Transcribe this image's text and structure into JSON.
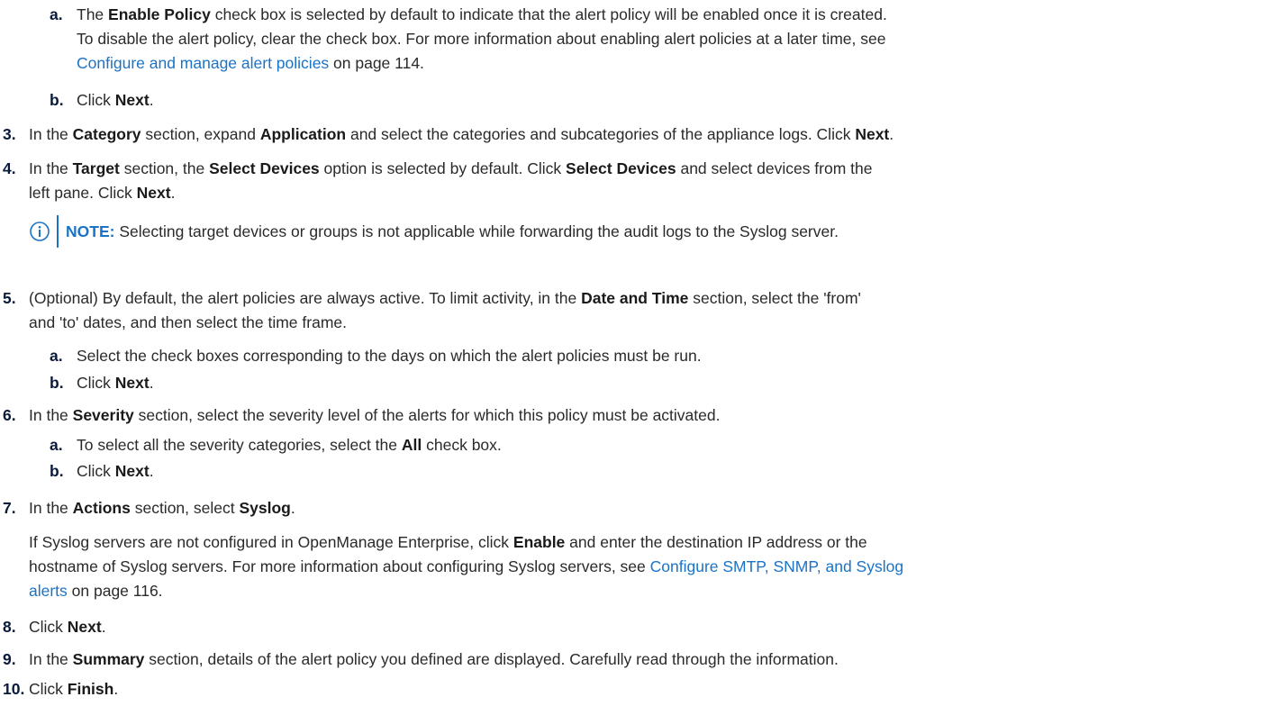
{
  "steps": {
    "s2a": {
      "marker": "a.",
      "p1": "The ",
      "b1": "Enable Policy",
      "p2": " check box is selected by default to indicate that the alert policy will be enabled once it is created."
    },
    "s2a_cont": {
      "p1": "To disable the alert policy, clear the check box. For more information about enabling alert policies at a later time, see"
    },
    "s2a_cont2": {
      "link": "Configure and manage alert policies",
      "p1": " on page 114."
    },
    "s2b": {
      "marker": "b.",
      "p1": "Click ",
      "b1": "Next",
      "p2": "."
    },
    "s3": {
      "marker": "3.",
      "p1": "In the ",
      "b1": "Category",
      "p2": " section, expand ",
      "b2": "Application",
      "p3": " and select the categories and subcategories of the appliance logs. Click ",
      "b3": "Next",
      "p4": "."
    },
    "s4": {
      "marker": "4.",
      "p1": "In the ",
      "b1": "Target",
      "p2": " section, the ",
      "b2": "Select Devices",
      "p3": " option is selected by default. Click ",
      "b3": "Select Devices",
      "p4": " and select devices from the"
    },
    "s4_cont": {
      "p1": "left pane. Click ",
      "b1": "Next",
      "p2": "."
    },
    "note": {
      "label": "NOTE:",
      "text": " Selecting target devices or groups is not applicable while forwarding the audit logs to the Syslog server.",
      "icon": "info-icon",
      "color": "#1a73c7"
    },
    "s5": {
      "marker": "5.",
      "p1": "(Optional) By default, the alert policies are always active. To limit activity, in the ",
      "b1": "Date and Time",
      "p2": " section, select the 'from'"
    },
    "s5_cont": {
      "p1": "and 'to' dates, and then select the time frame."
    },
    "s5a": {
      "marker": "a.",
      "p1": "Select the check boxes corresponding to the days on which the alert policies must be run."
    },
    "s5b": {
      "marker": "b.",
      "p1": "Click ",
      "b1": "Next",
      "p2": "."
    },
    "s6": {
      "marker": "6.",
      "p1": "In the ",
      "b1": "Severity",
      "p2": " section, select the severity level of the alerts for which this policy must be activated."
    },
    "s6a": {
      "marker": "a.",
      "p1": "To select all the severity categories, select the ",
      "b1": "All",
      "p2": " check box."
    },
    "s6b": {
      "marker": "b.",
      "p1": "Click ",
      "b1": "Next",
      "p2": "."
    },
    "s7": {
      "marker": "7.",
      "p1": "In the ",
      "b1": "Actions",
      "p2": " section, select ",
      "b2": "Syslog",
      "p3": "."
    },
    "s7_para1": {
      "p1": "If Syslog servers are not configured in OpenManage Enterprise, click ",
      "b1": "Enable",
      "p2": " and enter the destination IP address or the"
    },
    "s7_para2": {
      "p1": "hostname of Syslog servers. For more information about configuring Syslog servers, see ",
      "link": "Configure SMTP, SNMP, and Syslog"
    },
    "s7_para3": {
      "link": "alerts",
      "p1": " on page 116."
    },
    "s8": {
      "marker": "8.",
      "p1": "Click ",
      "b1": "Next",
      "p2": "."
    },
    "s9": {
      "marker": "9.",
      "p1": "In the ",
      "b1": "Summary",
      "p2": " section, details of the alert policy you defined are displayed. Carefully read through the information."
    },
    "s10": {
      "marker": "10.",
      "p1": "Click ",
      "b1": "Finish",
      "p2": "."
    }
  }
}
